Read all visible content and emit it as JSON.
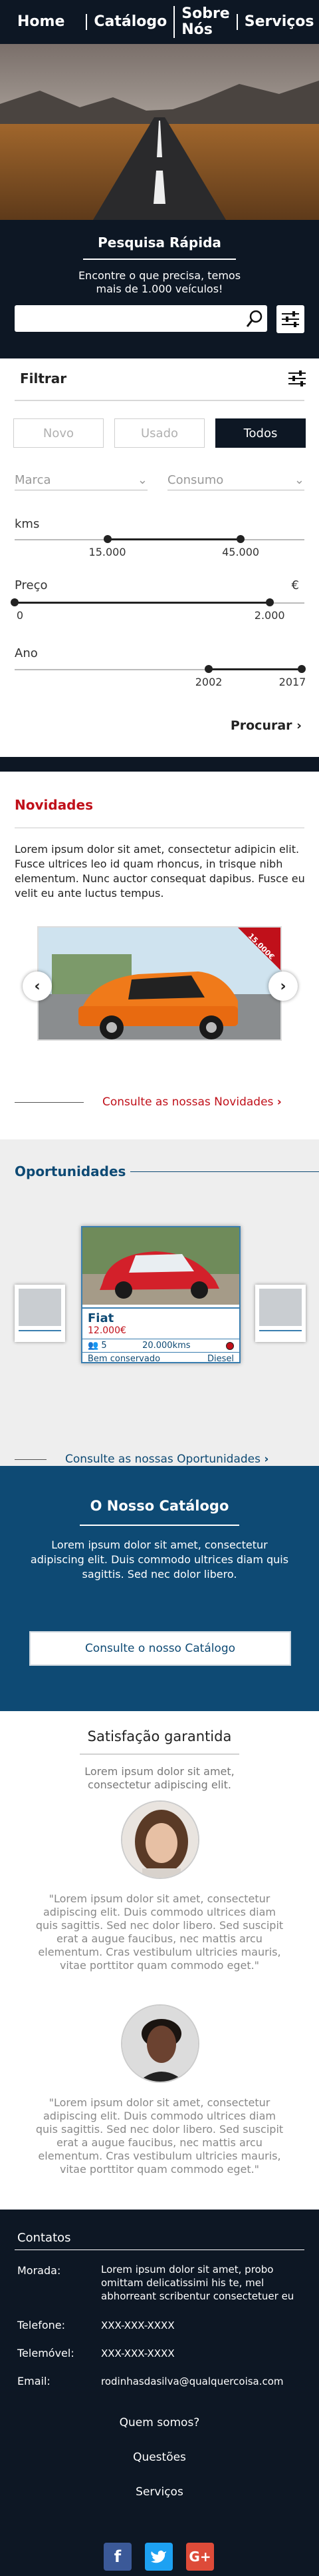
{
  "nav": {
    "items": [
      "Home",
      "Catálogo",
      "Sobre Nós",
      "Serviços"
    ]
  },
  "quick_search": {
    "title": "Pesquisa Rápida",
    "subtitle": "Encontre o que precisa, temos mais de 1.000 veículos!",
    "search_value": "",
    "search_icon": "search-icon",
    "filter_icon": "sliders-icon"
  },
  "filter": {
    "title": "Filtrar",
    "segments": [
      "Novo",
      "Usado",
      "Todos"
    ],
    "active_segment": "Todos",
    "brand_placeholder": "Marca",
    "consumption_placeholder": "Consumo",
    "km": {
      "label": "kms",
      "min": "15.000",
      "max": "45.000",
      "min_fraction": 0.32,
      "max_fraction": 0.78
    },
    "price": {
      "label": "Preço",
      "unit": "€",
      "min": "0",
      "max": "2.000",
      "min_fraction": 0.0,
      "max_fraction": 0.88
    },
    "year": {
      "label": "Ano",
      "min": "2002",
      "max": "2017",
      "min_fraction": 0.67,
      "max_fraction": 0.99
    },
    "search_button": "Procurar"
  },
  "novidades": {
    "title": "Novidades",
    "text": "Lorem ipsum dolor sit amet, consectetur adipicin elit. Fusce ultrices leo id quam rhoncus, in trisque nibh elementum. Nunc auctor consequat dapibus. Fusce eu velit eu ante luctus tempus.",
    "price_ribbon": "15.000€",
    "link": "Consulte as nossas Novidades"
  },
  "oportunidades": {
    "title": "Oportunidades",
    "card": {
      "name": "Fiat",
      "price": "12.000€",
      "seats": "5",
      "km": "20.000kms",
      "condition": "Bem conservado",
      "fuel": "Diesel"
    },
    "link": "Consulte as nossas Oportunidades"
  },
  "catalogo": {
    "title": "O Nosso Catálogo",
    "text": "Lorem ipsum dolor sit amet, consectetur adipiscing elit. Duis commodo ultrices diam quis sagittis. Sed nec dolor libero.",
    "button": "Consulte o nosso Catálogo"
  },
  "satisfacao": {
    "title": "Satisfação garantida",
    "subtitle": "Lorem ipsum dolor sit amet, consectetur adipiscing elit.",
    "quote1": "\"Lorem ipsum dolor sit amet, consectetur adipiscing elit. Duis commodo ultrices diam quis sagittis. Sed nec dolor libero. Sed suscipit erat a augue faucibus, nec mattis arcu elementum. Cras vestibulum ultricies mauris, vitae porttitor quam commodo eget.\"",
    "quote2": "\"Lorem ipsum dolor sit amet, consectetur adipiscing elit. Duis commodo ultrices diam quis sagittis. Sed nec dolor libero. Sed suscipit erat a augue faucibus, nec mattis arcu elementum. Cras vestibulum ultricies mauris, vitae porttitor quam commodo eget.\""
  },
  "footer": {
    "contacts_title": "Contatos",
    "morada_label": "Morada:",
    "morada_value": "Lorem ipsum dolor sit amet, probo omittam delicatissimi his te, mel abhorreant scribentur consectetuer eu",
    "telefone_label": "Telefone:",
    "telefone_value": "XXX-XXX-XXXX",
    "telemovel_label": "Telemóvel:",
    "telemovel_value": "XXX-XXX-XXXX",
    "email_label": "Email:",
    "email_value": "rodinhasdasilva@qualquercoisa.com",
    "links": [
      "Quem somos?",
      "Questões",
      "Serviços"
    ],
    "social_icons": [
      "facebook-icon",
      "twitter-icon",
      "google-plus-icon"
    ]
  },
  "colors": {
    "navy": "#0d1724",
    "blue": "#0e4a74",
    "red": "#c0101a",
    "car_orange": "#f07a1a"
  }
}
